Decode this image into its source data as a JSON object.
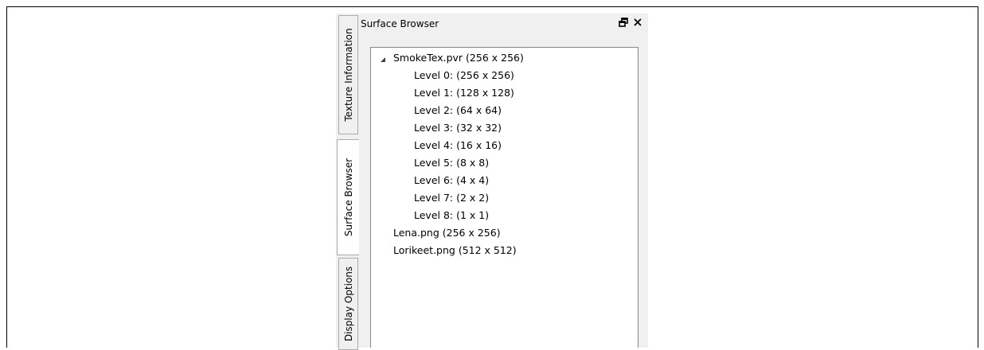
{
  "sidebar": {
    "tabs": [
      {
        "label": "Texture Information"
      },
      {
        "label": "Surface Browser"
      },
      {
        "label": "Display Options"
      }
    ]
  },
  "panel": {
    "title": "Surface Browser",
    "icons": [
      "float-icon",
      "close-icon"
    ]
  },
  "tree": {
    "root": {
      "label": "SmokeTex.pvr (256 x 256)",
      "expanded": true,
      "children": [
        {
          "label": "Level 0: (256 x 256)"
        },
        {
          "label": "Level 1: (128 x 128)"
        },
        {
          "label": "Level 2: (64 x 64)"
        },
        {
          "label": "Level 3: (32 x 32)"
        },
        {
          "label": "Level 4: (16 x 16)"
        },
        {
          "label": "Level 5: (8 x 8)"
        },
        {
          "label": "Level 6: (4 x 4)"
        },
        {
          "label": "Level 7: (2 x 2)"
        },
        {
          "label": "Level 8: (1 x 1)"
        }
      ]
    },
    "items": [
      {
        "label": "Lena.png (256 x 256)"
      },
      {
        "label": "Lorikeet.png (512 x 512)"
      }
    ]
  }
}
